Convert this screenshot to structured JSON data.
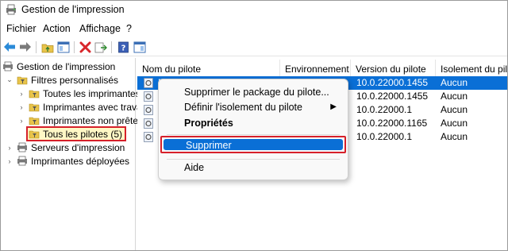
{
  "window": {
    "title": "Gestion de l'impression"
  },
  "menu": [
    "Fichier",
    "Action",
    "Affichage",
    "?"
  ],
  "tree": {
    "root": "Gestion de l'impression",
    "custom_filters": "Filtres personnalisés",
    "filters": [
      "Toutes les imprimantes (",
      "Imprimantes avec travau",
      "Imprimantes non prêtes",
      "Tous les pilotes (5)"
    ],
    "print_servers": "Serveurs d'impression",
    "deployed_printers": "Imprimantes déployées"
  },
  "list": {
    "columns": [
      "Nom du pilote",
      "Environnement",
      "Version du pilote",
      "Isolement du pilote"
    ],
    "rows": [
      {
        "name": "M",
        "env": "",
        "version": "10.0.22000.1455",
        "isolation": "Aucun",
        "selected": true
      },
      {
        "name": "M",
        "env": "",
        "version": "10.0.22000.1455",
        "isolation": "Aucun",
        "selected": false
      },
      {
        "name": "M",
        "env": "",
        "version": "10.0.22000.1",
        "isolation": "Aucun",
        "selected": false
      },
      {
        "name": "M",
        "env": "",
        "version": "10.0.22000.1165",
        "isolation": "Aucun",
        "selected": false
      },
      {
        "name": "M",
        "env": "",
        "version": "10.0.22000.1",
        "isolation": "Aucun",
        "selected": false
      }
    ]
  },
  "context_menu": {
    "items": [
      "Supprimer le package du pilote...",
      "Définir l'isolement du pilote",
      "Propriétés",
      "Supprimer",
      "Aide"
    ]
  },
  "colors": {
    "selection": "#0a6fd6",
    "highlight_border": "#d6202a"
  }
}
